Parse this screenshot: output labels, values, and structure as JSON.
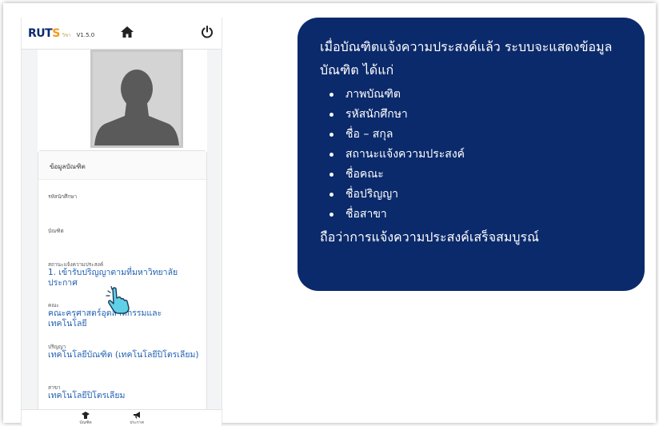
{
  "app": {
    "logo_main": "RUT",
    "logo_accent": "S",
    "logo_sub": "วิชา",
    "version": "V1.5.0",
    "profile": {
      "section_title": "ข้อมูลบัณฑิต",
      "student_id_label": "รหัสนักศึกษา",
      "student_id_value": "",
      "graduate_label": "บัณฑิต",
      "graduate_value": "",
      "status_label": "สถานะแจ้งความประสงค์",
      "status_value": "1. เข้ารับปริญญาตามที่มหาวิทยาลัยประกาศ",
      "faculty_label": "คณะ",
      "faculty_value": "คณะครุศาสตร์อุตสาหกรรมและเทคโนโลยี",
      "degree_label": "ปริญญา",
      "degree_value": "เทคโนโลยีบัณฑิต (เทคโนโลยีปิโตรเลียม)",
      "major_label": "สาขา",
      "major_value": "เทคโนโลยีปิโตรเลียม"
    },
    "bottom_nav": [
      {
        "label": "บัณฑิต",
        "icon": "graduate-icon"
      },
      {
        "label": "ประกาศ",
        "icon": "megaphone-icon"
      }
    ]
  },
  "callout": {
    "intro": "เมื่อบัณฑิตแจ้งความประสงค์แล้ว ระบบจะแสดงข้อมูลบัณฑิต ได้แก่",
    "items": [
      "ภาพบัณฑิต",
      "รหัสนักศึกษา",
      "ชื่อ – สกุล",
      "สถานะแจ้งความประสงค์",
      "ชื่อคณะ",
      "ชื่อปริญญา",
      "ชื่อสาขา"
    ],
    "outro": "ถือว่าการแจ้งความประสงค์เสร็จสมบูรณ์"
  },
  "colors": {
    "callout_bg": "#0b2a6b",
    "link_blue": "#1f5fb3",
    "logo_navy": "#0a2a6b",
    "logo_orange": "#f29a1a"
  }
}
